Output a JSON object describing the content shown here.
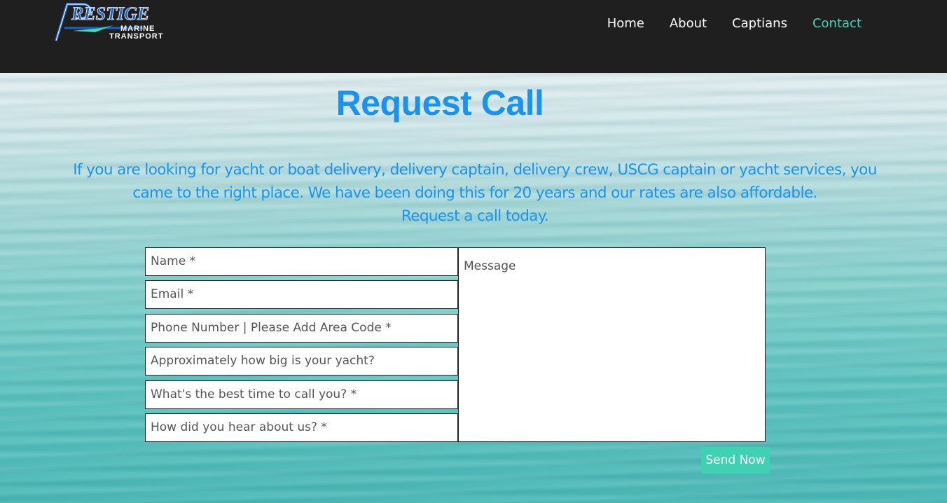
{
  "header": {
    "logo": {
      "word": "RESTIGE",
      "initial": "P",
      "line2": "MARINE",
      "line3": "TRANSPORT"
    },
    "nav": [
      {
        "label": "Home",
        "active": false
      },
      {
        "label": "About",
        "active": false
      },
      {
        "label": "Captians",
        "active": false
      },
      {
        "label": "Contact",
        "active": true
      }
    ]
  },
  "main": {
    "title": "Request Call",
    "intro_lines": [
      "If you are looking for yacht or boat delivery, delivery captain, delivery crew, USCG captain or yacht services, you",
      "came to the right place. We have been doing this for 20 years and our rates are also affordable.",
      "Request a call today."
    ]
  },
  "form": {
    "fields": [
      {
        "placeholder": "Name *"
      },
      {
        "placeholder": "Email *"
      },
      {
        "placeholder": "Phone Number | Please Add Area Code *"
      },
      {
        "placeholder": "Approximately how big is your yacht?"
      },
      {
        "placeholder": "What's the best time to call you? *"
      },
      {
        "placeholder": "How did you hear about us? *"
      }
    ],
    "message_placeholder": "Message",
    "submit_label": "Send Now"
  },
  "colors": {
    "accent_blue": "#1a92f0",
    "accent_teal": "#3fd1b1",
    "header_bg": "#1f1f1f"
  }
}
